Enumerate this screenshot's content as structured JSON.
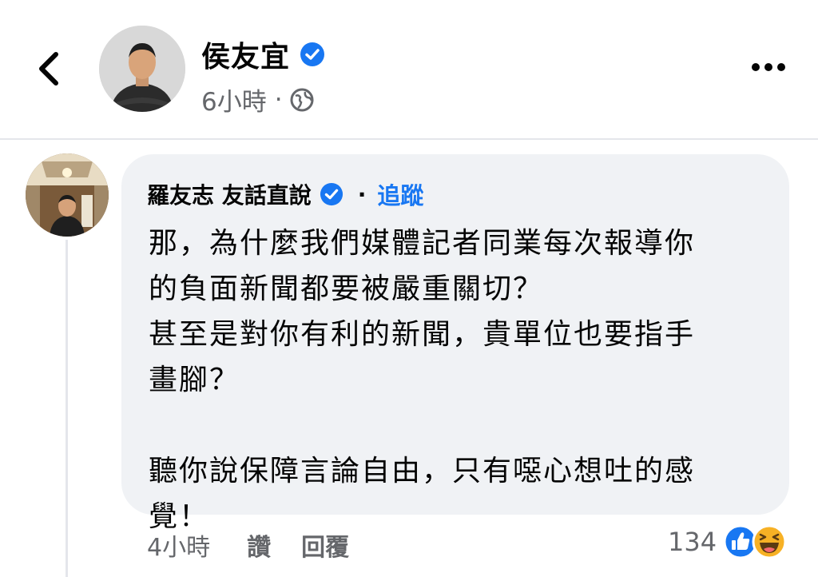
{
  "post_header": {
    "author_name": "侯友宜",
    "time": "6小時",
    "separator": "·",
    "icons": [
      "back-arrow-icon",
      "verified-badge-icon",
      "globe-icon",
      "more-options-icon"
    ]
  },
  "comment": {
    "commenter_name": "羅友志 友話直說",
    "separator": "·",
    "follow_label": "追蹤",
    "text": "那，為什麼我們媒體記者同業每次報導你\n的負面新聞都要被嚴重關切？\n甚至是對你有利的新聞，貴單位也要指手\n畫腳？\n\n聽你說保障言論自由，只有噁心想吐的感\n覺！",
    "time": "4小時",
    "like_label": "讚",
    "reply_label": "回覆",
    "reaction_count": "134",
    "reaction_icons": [
      "like-reaction-icon",
      "haha-reaction-icon"
    ]
  },
  "colors": {
    "accent_blue": "#1877f2",
    "secondary_text": "#65676b",
    "bubble_bg": "#f0f2f5",
    "haha_yellow": "#f7b125"
  }
}
